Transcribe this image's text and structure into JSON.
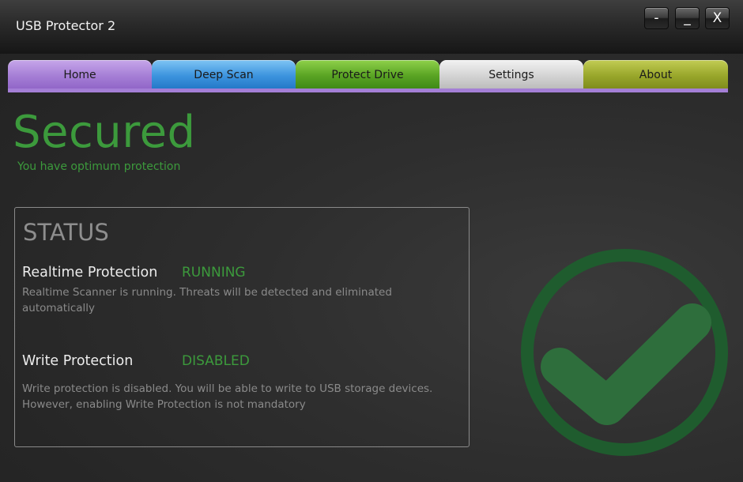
{
  "window": {
    "title": "USB Protector 2",
    "controls": {
      "minimize_alt": "-",
      "minimize": "_",
      "close": "X"
    }
  },
  "tabs": [
    {
      "label": "Home",
      "color": "#a67fd6",
      "selected": true
    },
    {
      "label": "Deep Scan",
      "color": "#3d94de"
    },
    {
      "label": "Protect Drive",
      "color": "#5aa424"
    },
    {
      "label": "Settings",
      "color": "#d4d4d4"
    },
    {
      "label": "About",
      "color": "#99a72b"
    }
  ],
  "hero": {
    "status": "Secured",
    "subtitle": "You have optimum protection",
    "color": "#3c9a3c",
    "icon": "checkmark-icon"
  },
  "status_panel": {
    "title": "STATUS",
    "rows": [
      {
        "label": "Realtime Protection",
        "state": "RUNNING",
        "description_lines": [
          "Realtime Scanner is running. Threats will be detected and eliminated automatically"
        ]
      },
      {
        "label": "Write Protection",
        "state": "DISABLED",
        "description_lines": [
          "Write protection is disabled. You will be able to write to USB storage devices.",
          "However, enabling Write Protection is not mandatory"
        ]
      }
    ]
  }
}
